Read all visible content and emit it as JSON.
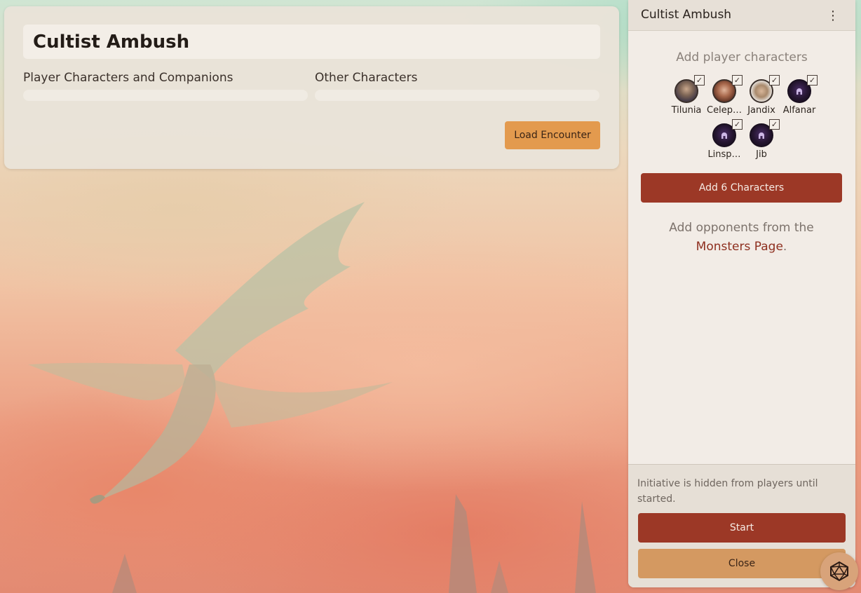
{
  "encounter": {
    "title": "Cultist Ambush",
    "columns": {
      "players": "Player Characters and Companions",
      "others": "Other Characters"
    },
    "load_button": "Load Encounter"
  },
  "panel": {
    "title": "Cultist Ambush",
    "menu_icon": "kebab-menu-icon",
    "add_players_label": "Add player characters",
    "characters": [
      {
        "name": "Tilunia",
        "checked": true,
        "avatar": "portrait"
      },
      {
        "name": "Celep…",
        "checked": true,
        "avatar": "portrait"
      },
      {
        "name": "Jandix",
        "checked": true,
        "avatar": "portrait"
      },
      {
        "name": "Alfanar",
        "checked": true,
        "avatar": "default-helm"
      },
      {
        "name": "Linsp…",
        "checked": true,
        "avatar": "default-helm"
      },
      {
        "name": "Jib",
        "checked": true,
        "avatar": "default-helm"
      }
    ],
    "check_mark": "✓",
    "add_characters_button": "Add 6 Characters",
    "opponents_text": "Add opponents from the ",
    "opponents_link": "Monsters Page",
    "opponents_end": ".",
    "footer_note": "Initiative is hidden from players until started.",
    "start_button": "Start",
    "close_button": "Close"
  },
  "dice_button_icon": "d20-icon"
}
